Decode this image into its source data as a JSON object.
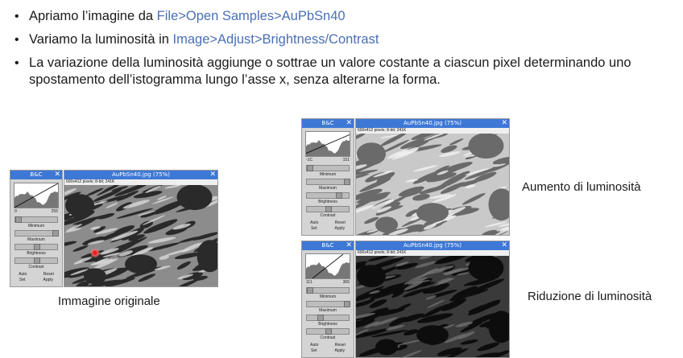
{
  "bullets": [
    {
      "prefix": "Apriamo l’imagine da ",
      "link": "File>Open Samples>AuPbSn40",
      "suffix": ""
    },
    {
      "prefix": "Variamo la luminosità in ",
      "link": "Image>Adjust>Brightness/Contrast",
      "suffix": ""
    },
    {
      "prefix": "La variazione della luminosità aggiunge o sottrae  un valore costante a ciascun pixel determinando uno spostamento dell’istogramma lungo l’asse x, senza alterarne la forma.",
      "link": "",
      "suffix": ""
    }
  ],
  "panels": [
    {
      "id": "original",
      "bc_title": "B&C",
      "image_title": "AuPbSn40.jpg (75%)",
      "image_info": "600x412 pixels; 8-bit; 241K",
      "hist_min": "0",
      "hist_max": "255",
      "labels": {
        "minimum": "Minimum",
        "maximum": "Maximum",
        "brightness": "Brightness",
        "contrast": "Contrast"
      },
      "buttons": {
        "auto": "Auto",
        "reset": "Reset",
        "set": "Set",
        "apply": "Apply"
      },
      "brightness_level": 0.5,
      "caption": "Immagine originale"
    },
    {
      "id": "increased",
      "bc_title": "B&C",
      "image_title": "AuPbSn40.jpg (75%)",
      "image_info": "600x412 pixels; 8-bit; 241K",
      "hist_min": "-1C",
      "hist_max": "151",
      "labels": {
        "minimum": "Minimum",
        "maximum": "Maximum",
        "brightness": "Brightness",
        "contrast": "Contrast"
      },
      "buttons": {
        "auto": "Auto",
        "reset": "Reset",
        "set": "Set",
        "apply": "Apply"
      },
      "brightness_level": 0.75,
      "caption": "Aumento di luminosità"
    },
    {
      "id": "decreased",
      "bc_title": "B&C",
      "image_title": "AuPbSn40.jpg (75%)",
      "image_info": "600x412 pixels; 8-bit; 241K",
      "hist_min": "111",
      "hist_max": "365",
      "labels": {
        "minimum": "Minimum",
        "maximum": "Maximum",
        "brightness": "Brightness",
        "contrast": "Contrast"
      },
      "buttons": {
        "auto": "Auto",
        "reset": "Reset",
        "set": "Set",
        "apply": "Apply"
      },
      "brightness_level": 0.3,
      "caption": "Riduzione di luminosità"
    }
  ],
  "colors": {
    "titlebar": "#3d78d6",
    "link": "#4a6fb5",
    "cursor": "#e02020"
  }
}
